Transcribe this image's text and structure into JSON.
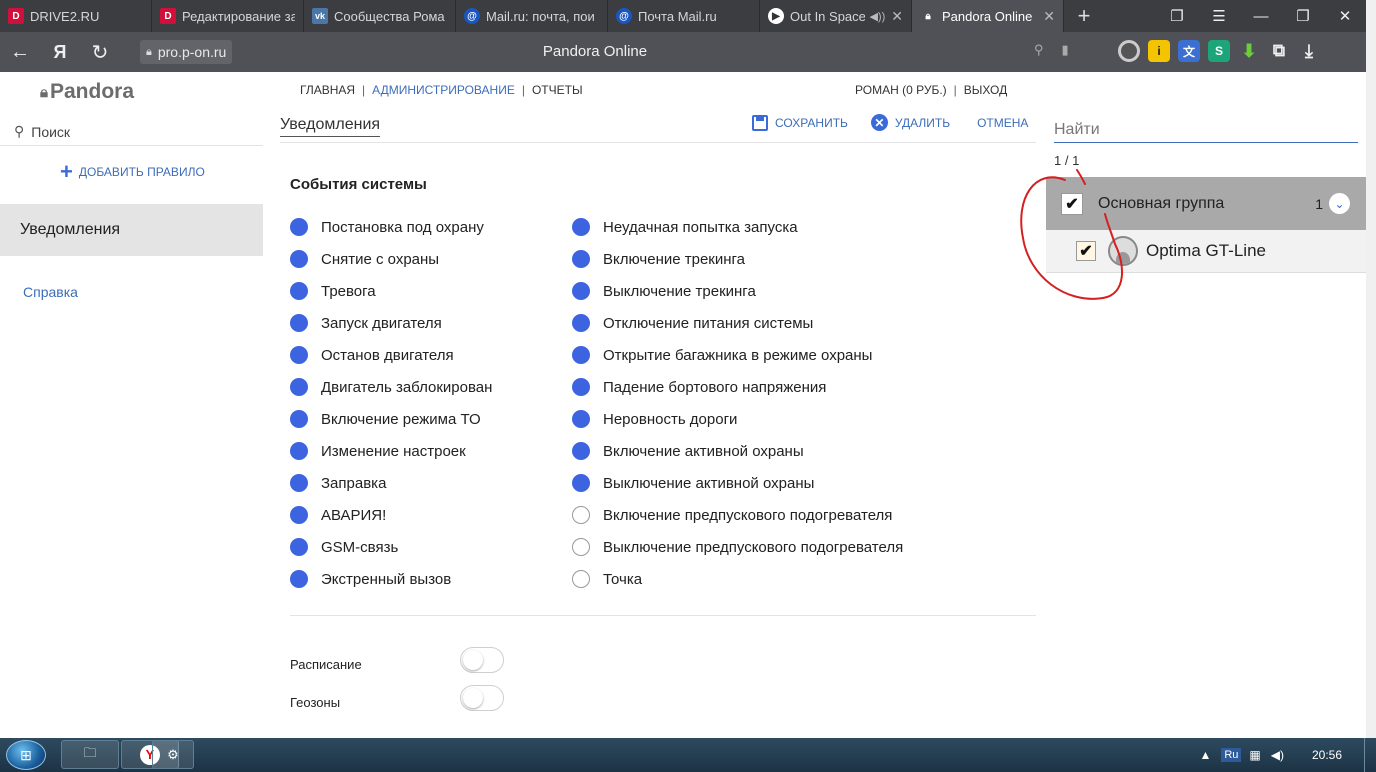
{
  "browser": {
    "tabs": [
      {
        "label": "DRIVE2.RU",
        "icon": "drive2-favicon",
        "active": false
      },
      {
        "label": "Редактирование за",
        "icon": "drive2-favicon",
        "active": false
      },
      {
        "label": "Сообщества Рома",
        "icon": "vk-favicon",
        "active": false
      },
      {
        "label": "Mail.ru: почта, пои",
        "icon": "mail-favicon",
        "active": false
      },
      {
        "label": "Почта Mail.ru",
        "icon": "mail-favicon",
        "active": false
      },
      {
        "label": "Out In Space",
        "icon": "youtube-favicon",
        "active": false,
        "audio": true
      },
      {
        "label": "Pandora Online",
        "icon": "lock-favicon",
        "active": true
      }
    ],
    "url": "pro.p-on.ru",
    "page_title": "Pandora Online",
    "yandex_button": "Я"
  },
  "app": {
    "logo_text": "Pandora",
    "search_label": "Поиск",
    "add_rule_label": "ДОБАВИТЬ ПРАВИЛО",
    "sidebar_active": "Уведомления",
    "help_link": "Справка"
  },
  "topnav": {
    "home": "ГЛАВНАЯ",
    "admin": "АДМИНИСТРИРОВАНИЕ",
    "reports": "ОТЧЕТЫ",
    "user": "РОМАН (0 РУБ.)",
    "logout": "ВЫХОД"
  },
  "content": {
    "title": "Уведомления",
    "save": "СОХРАНИТЬ",
    "delete": "УДАЛИТЬ",
    "cancel": "ОТМЕНА",
    "events_title": "События системы",
    "events_left": [
      {
        "label": "Постановка под охрану",
        "on": true
      },
      {
        "label": "Снятие с охраны",
        "on": true
      },
      {
        "label": "Тревога",
        "on": true
      },
      {
        "label": "Запуск двигателя",
        "on": true
      },
      {
        "label": "Останов двигателя",
        "on": true
      },
      {
        "label": "Двигатель заблокирован",
        "on": true
      },
      {
        "label": "Включение режима ТО",
        "on": true
      },
      {
        "label": "Изменение настроек",
        "on": true
      },
      {
        "label": "Заправка",
        "on": true
      },
      {
        "label": "АВАРИЯ!",
        "on": true
      },
      {
        "label": "GSM-связь",
        "on": true
      },
      {
        "label": "Экстренный вызов",
        "on": true
      }
    ],
    "events_right": [
      {
        "label": "Неудачная попытка запуска",
        "on": true
      },
      {
        "label": "Включение трекинга",
        "on": true
      },
      {
        "label": "Выключение трекинга",
        "on": true
      },
      {
        "label": "Отключение питания системы",
        "on": true
      },
      {
        "label": "Открытие багажника в режиме охраны",
        "on": true
      },
      {
        "label": "Падение бортового напряжения",
        "on": true
      },
      {
        "label": "Неровность дороги",
        "on": true
      },
      {
        "label": "Включение активной охраны",
        "on": true
      },
      {
        "label": "Выключение активной охраны",
        "on": true
      },
      {
        "label": "Включение предпускового подогревателя",
        "on": false
      },
      {
        "label": "Выключение предпускового подогревателя",
        "on": false
      },
      {
        "label": "Точка",
        "on": false
      }
    ],
    "schedule_label": "Расписание",
    "schedule_on": false,
    "geozones_label": "Геозоны",
    "geozones_on": false
  },
  "right_panel": {
    "search_placeholder": "Найти",
    "count": "1 / 1",
    "group_label": "Основная группа",
    "group_count": "1",
    "group_checked": true,
    "device_label": "Optima GT-Line",
    "device_checked": true
  },
  "taskbar": {
    "lang": "Ru",
    "clock": "20:56"
  },
  "colors": {
    "accent": "#3d6db9",
    "dot_on": "#3d63e0",
    "group_bg": "#a9a9a9",
    "annotation": "#d42020"
  }
}
